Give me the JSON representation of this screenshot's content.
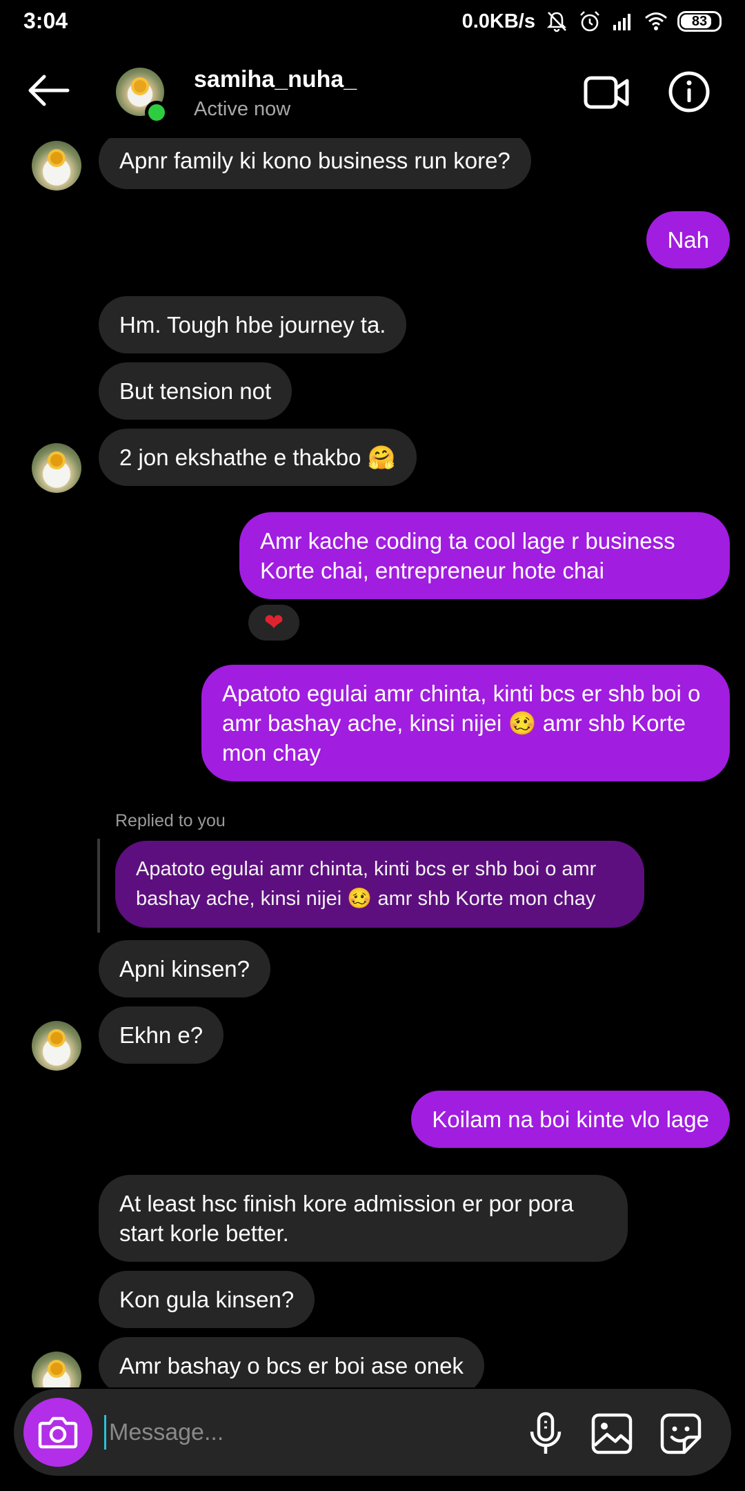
{
  "status_bar": {
    "time": "3:04",
    "net_speed": "0.0KB/s",
    "battery": "83",
    "battery_level_percent": 83,
    "icons": [
      "mute-bell-icon",
      "alarm-icon",
      "signal-icon",
      "wifi-icon",
      "battery-icon"
    ]
  },
  "header": {
    "username": "samiha_nuha_",
    "status": "Active now",
    "icons": [
      "back-arrow-icon",
      "video-call-icon",
      "info-icon"
    ],
    "online_color": "#2ecc40"
  },
  "messages": [
    {
      "side": "in",
      "text": "Apnr family ki kono business run kore?"
    },
    {
      "side": "out",
      "text": "Nah"
    },
    {
      "side": "in",
      "text": "Hm. Tough hbe journey ta."
    },
    {
      "side": "in",
      "text": "But tension not"
    },
    {
      "side": "in",
      "text": "2 jon ekshathe e thakbo 🤗"
    },
    {
      "side": "out",
      "text": "Amr kache coding ta cool lage r business Korte chai, entrepreneur hote chai",
      "reaction": "❤"
    },
    {
      "side": "out",
      "text": "Apatoto egulai amr chinta, kinti bcs er shb boi o amr bashay ache, kinsi nijei 🥴 amr shb Korte mon chay"
    },
    {
      "side": "in",
      "replied_label": "Replied to you",
      "reply_quote": "Apatoto egulai amr chinta, kinti bcs er shb boi o amr bashay ache, kinsi nijei 🥴 amr shb Korte mon chay"
    },
    {
      "side": "in",
      "text": "Apni kinsen?"
    },
    {
      "side": "in",
      "text": "Ekhn e?"
    },
    {
      "side": "out",
      "text": "Koilam na boi kinte vlo lage"
    },
    {
      "side": "in",
      "text": "At least hsc finish kore admission er por pora start korle better."
    },
    {
      "side": "in",
      "text": "Kon gula kinsen?"
    },
    {
      "side": "in",
      "text": "Amr bashay o bcs er boi ase onek"
    }
  ],
  "composer": {
    "placeholder": "Message...",
    "icons": [
      "camera-icon",
      "microphone-icon",
      "gallery-icon",
      "sticker-icon"
    ]
  },
  "colors": {
    "outgoing_bubble": "#a11de0",
    "incoming_bubble": "#262626",
    "reply_bubble": "#5d0f7f",
    "background": "#000000"
  }
}
